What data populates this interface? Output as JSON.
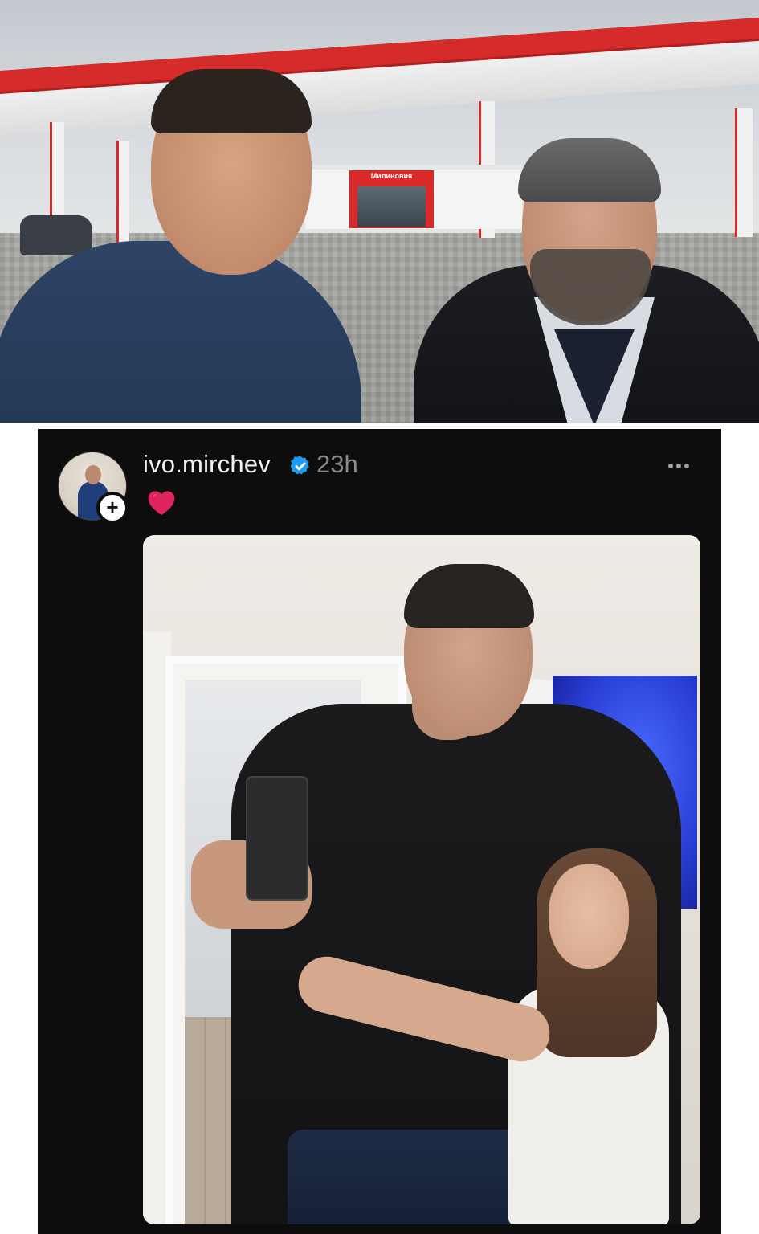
{
  "post": {
    "username": "ivo.mirchev",
    "verified": true,
    "timestamp": "23h",
    "reaction": "heart",
    "accent_verified": "#1d9bf0",
    "heart_color": "#e0245e",
    "more_icon": "more-horizontal-icon",
    "follow_icon": "plus-icon"
  },
  "top_photo": {
    "station_sign": "Милиновия"
  }
}
